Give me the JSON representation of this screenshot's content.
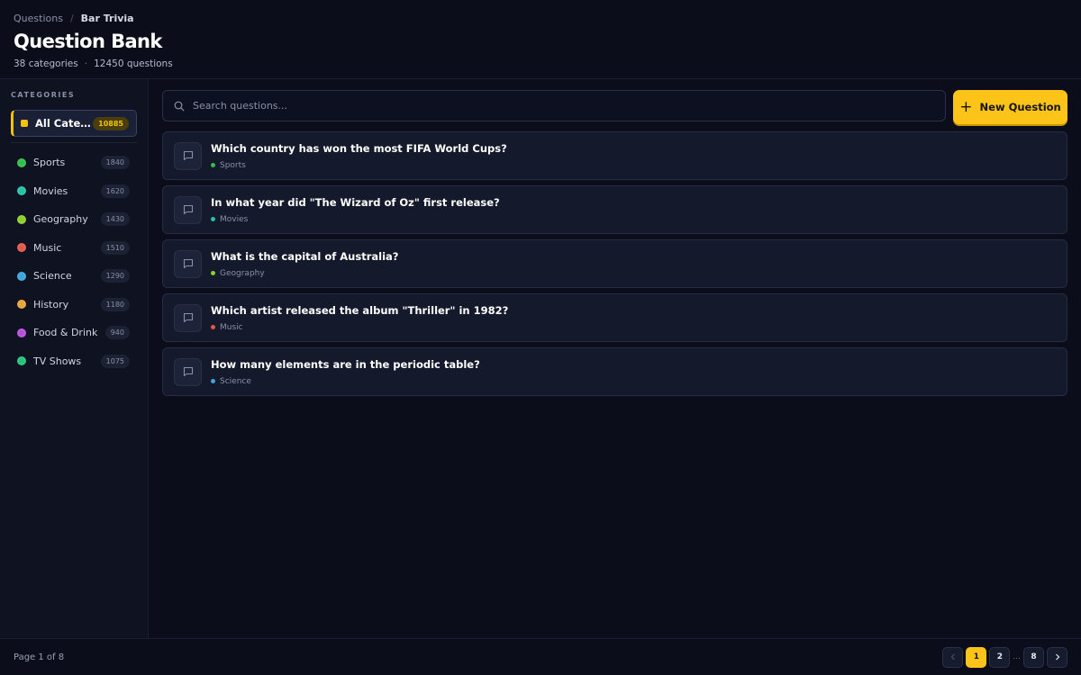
{
  "header": {
    "breadcrumb": {
      "parent": "Questions",
      "separator": "/",
      "current": "Bar Trivia"
    },
    "title": "Question Bank",
    "stats": {
      "categories": "38 categories",
      "separator": "·",
      "questions": "12450 questions"
    }
  },
  "sidebar": {
    "heading": "CATEGORIES",
    "all": {
      "label": "All Categories",
      "count": "10885",
      "color": "#f2c20f"
    },
    "items": [
      {
        "label": "Sports",
        "count": "1840",
        "color": "#2fbf4a"
      },
      {
        "label": "Movies",
        "count": "1620",
        "color": "#22c3a6"
      },
      {
        "label": "Geography",
        "count": "1430",
        "color": "#8bd12a"
      },
      {
        "label": "Music",
        "count": "1510",
        "color": "#e4574a"
      },
      {
        "label": "Science",
        "count": "1290",
        "color": "#3aa6dd"
      },
      {
        "label": "History",
        "count": "1180",
        "color": "#e9a537"
      },
      {
        "label": "Food & Drink",
        "count": "940",
        "color": "#b74fdc"
      },
      {
        "label": "TV Shows",
        "count": "1075",
        "color": "#23c47c"
      }
    ]
  },
  "search": {
    "placeholder": "Search questions...",
    "icon": "search-icon"
  },
  "actions": {
    "new_question_label": "New Question"
  },
  "questions": [
    {
      "text": "Which country has won the most FIFA World Cups?",
      "category": "Sports",
      "color": "#2fbf4a"
    },
    {
      "text": "In what year did \"The Wizard of Oz\" first release?",
      "category": "Movies",
      "color": "#22c3a6"
    },
    {
      "text": "What is the capital of Australia?",
      "category": "Geography",
      "color": "#8bd12a"
    },
    {
      "text": "Which artist released the album \"Thriller\" in 1982?",
      "category": "Music",
      "color": "#e4574a"
    },
    {
      "text": "How many elements are in the periodic table?",
      "category": "Science",
      "color": "#3aa6dd"
    }
  ],
  "footer": {
    "page_info": "Page 1 of 8",
    "pages": {
      "first": "1",
      "second": "2",
      "ellipsis": "...",
      "last": "8"
    },
    "prev_icon": "chevron-left-icon",
    "next_icon": "chevron-right-icon"
  },
  "colors": {
    "accent": "#fcc419",
    "background": "#0b0e1a",
    "card": "#141a2c"
  }
}
